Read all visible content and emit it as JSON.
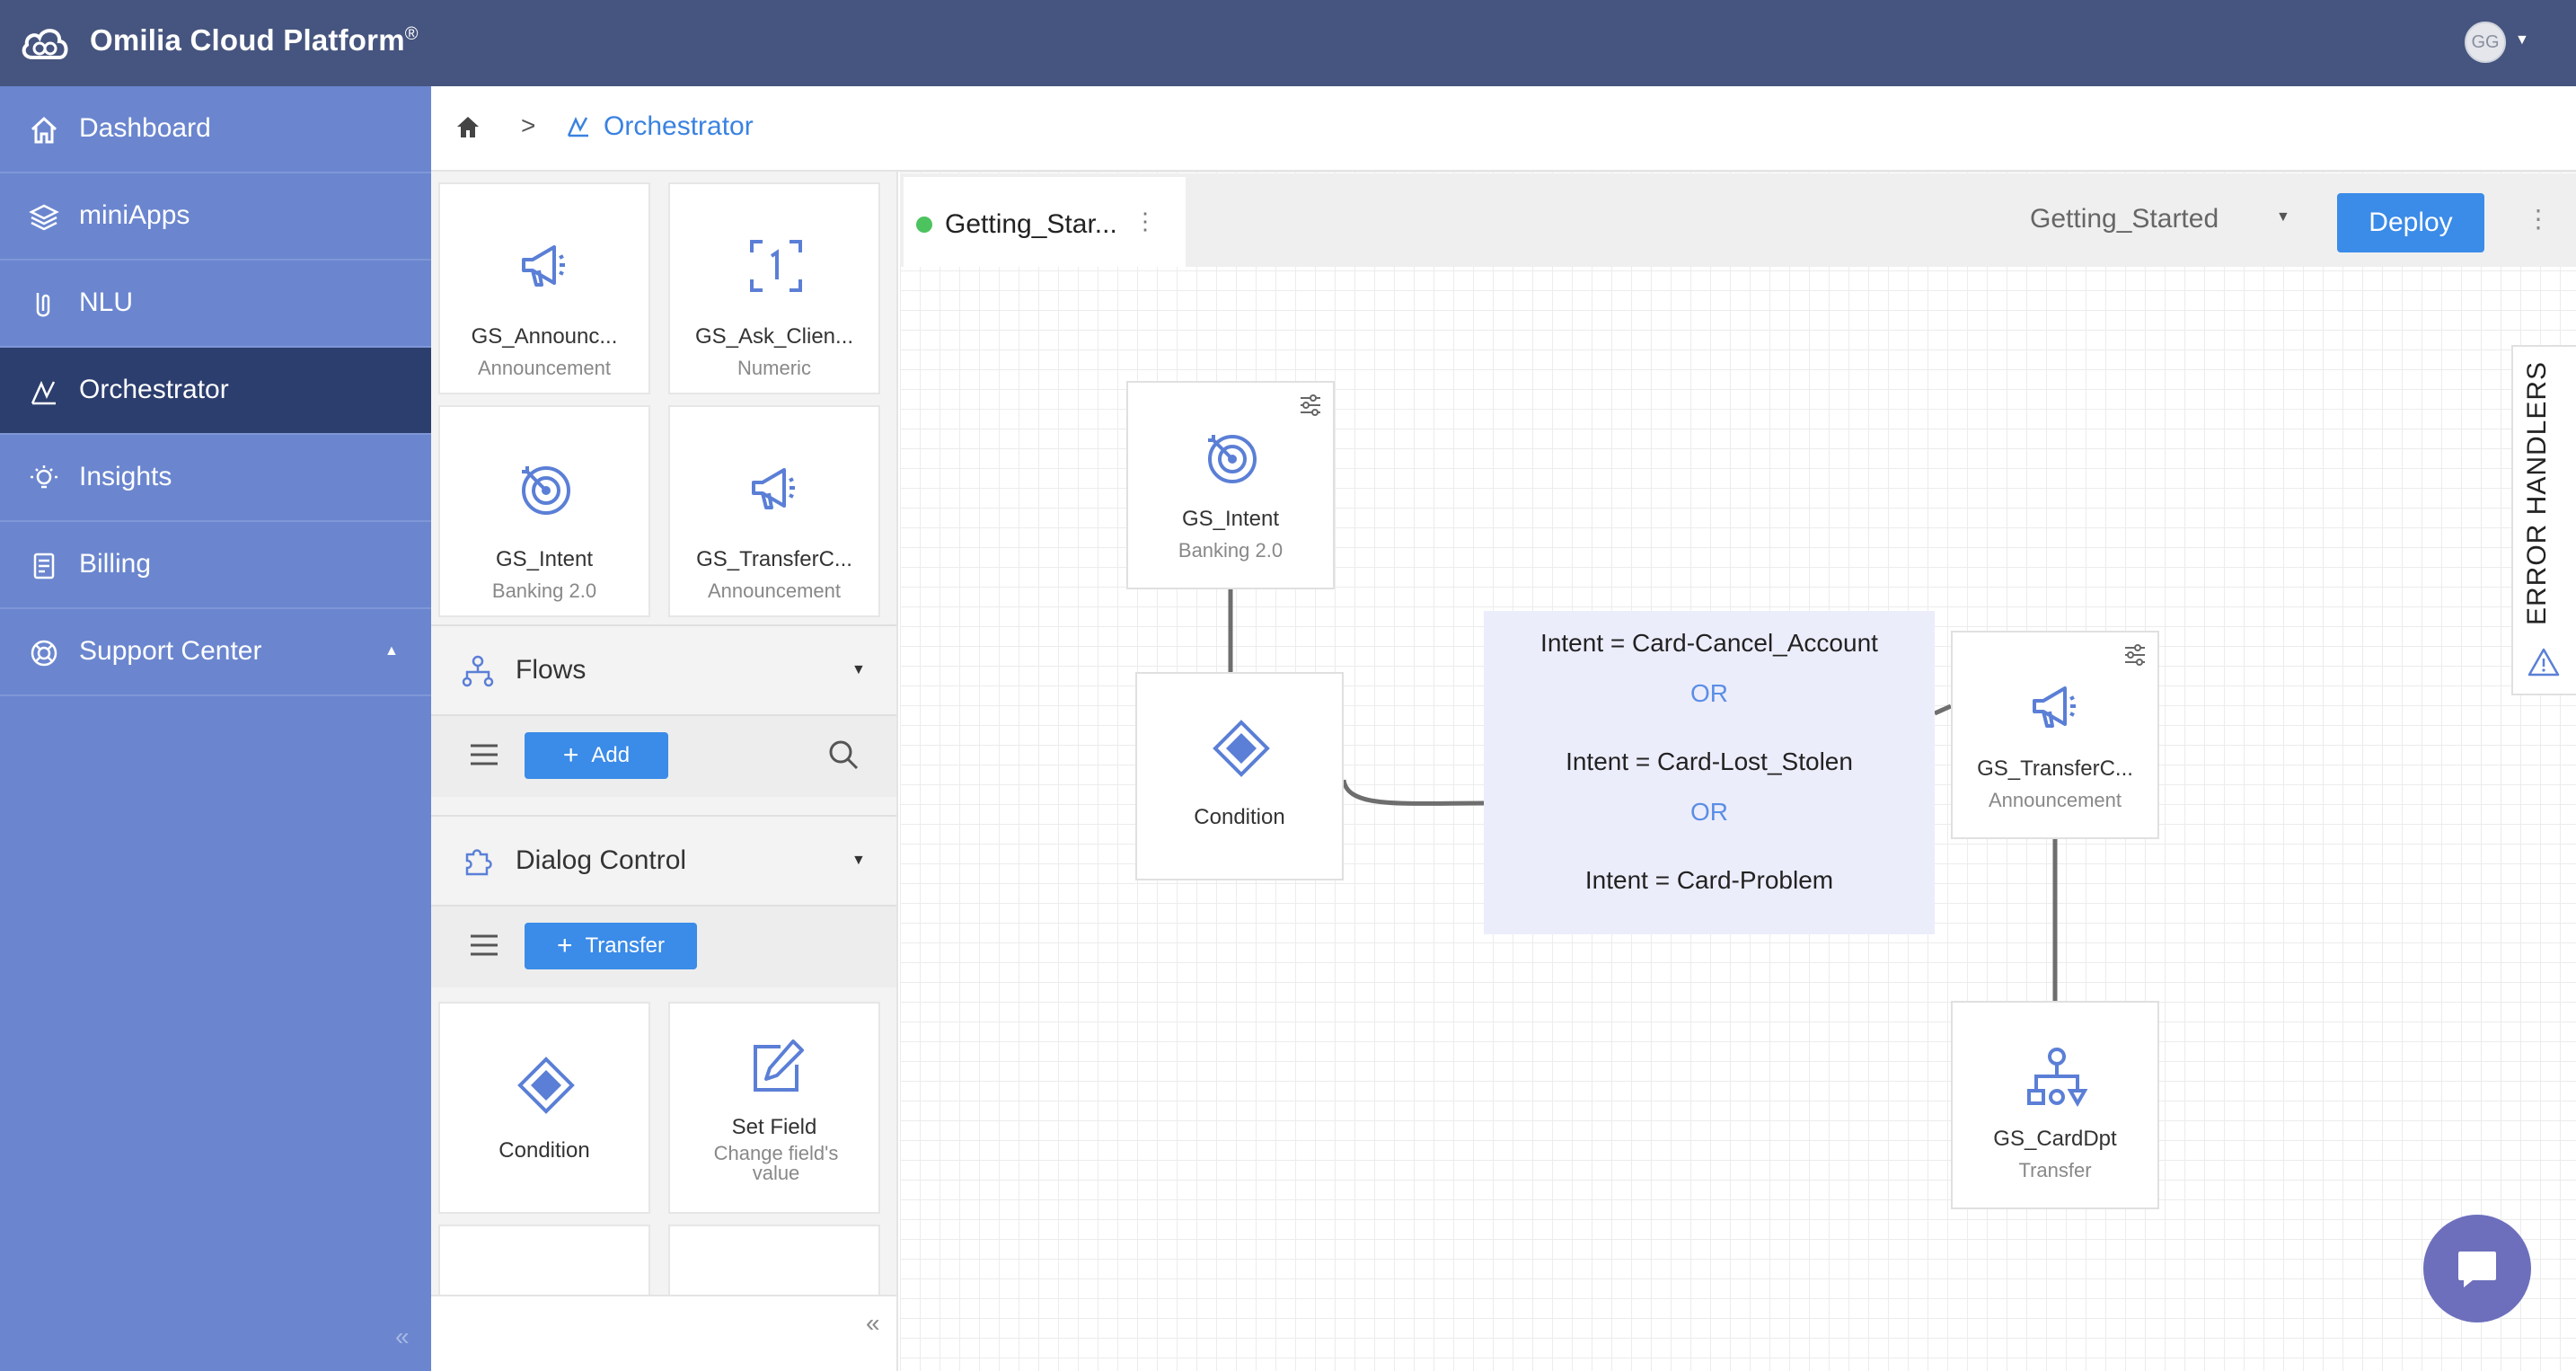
{
  "app": {
    "title": "Omilia Cloud Platform",
    "trademark": "®",
    "avatar_initials": "GG"
  },
  "sidebar": {
    "items": [
      {
        "label": "Dashboard",
        "icon": "home-icon"
      },
      {
        "label": "miniApps",
        "icon": "layers-icon"
      },
      {
        "label": "NLU",
        "icon": "nlu-icon"
      },
      {
        "label": "Orchestrator",
        "icon": "orchestrator-icon",
        "active": true
      },
      {
        "label": "Insights",
        "icon": "lightbulb-icon"
      },
      {
        "label": "Billing",
        "icon": "billing-icon"
      },
      {
        "label": "Support Center",
        "icon": "lifebuoy-icon"
      }
    ],
    "collapse_glyph": "«"
  },
  "breadcrumb": {
    "current": "Orchestrator",
    "separator": ">"
  },
  "palette": {
    "cards_top": [
      {
        "name": "GS_Announc...",
        "type": "Announcement",
        "icon": "megaphone-icon"
      },
      {
        "name": "GS_Ask_Clien...",
        "type": "Numeric",
        "icon": "numeric-icon"
      },
      {
        "name": "GS_Intent",
        "type": "Banking 2.0",
        "icon": "target-icon"
      },
      {
        "name": "GS_TransferC...",
        "type": "Announcement",
        "icon": "megaphone-icon"
      }
    ],
    "flows": {
      "title": "Flows",
      "add_label": "Add"
    },
    "dialog_control": {
      "title": "Dialog Control",
      "transfer_label": "Transfer"
    },
    "cards_bottom": [
      {
        "name": "Condition",
        "type": "",
        "icon": "diamond-icon"
      },
      {
        "name": "Set Field",
        "type": "Change field's value",
        "icon": "edit-icon"
      }
    ],
    "collapse_glyph": "«"
  },
  "canvas": {
    "tab": {
      "label": "Getting_Star...",
      "status_color": "#4cc35e"
    },
    "flow_select": "Getting_Started",
    "deploy_label": "Deploy",
    "error_handlers_label": "ERROR HANDLERS",
    "nodes": {
      "intent": {
        "name": "GS_Intent",
        "type": "Banking 2.0"
      },
      "condition": {
        "name": "Condition"
      },
      "transfer_announce": {
        "name": "GS_TransferC...",
        "type": "Announcement"
      },
      "card_dpt": {
        "name": "GS_CardDpt",
        "type": "Transfer"
      }
    },
    "condition_rules": {
      "line1": "Intent = Card-Cancel_Account",
      "or1": "OR",
      "line2": "Intent = Card-Lost_Stolen",
      "or2": "OR",
      "line3": "Intent = Card-Problem"
    }
  },
  "colors": {
    "topbar": "#46557f",
    "sidebar": "#6b86cf",
    "sidebar_active": "#2c3e6e",
    "accent": "#3b8be8",
    "node_icon": "#5b7fd6"
  }
}
